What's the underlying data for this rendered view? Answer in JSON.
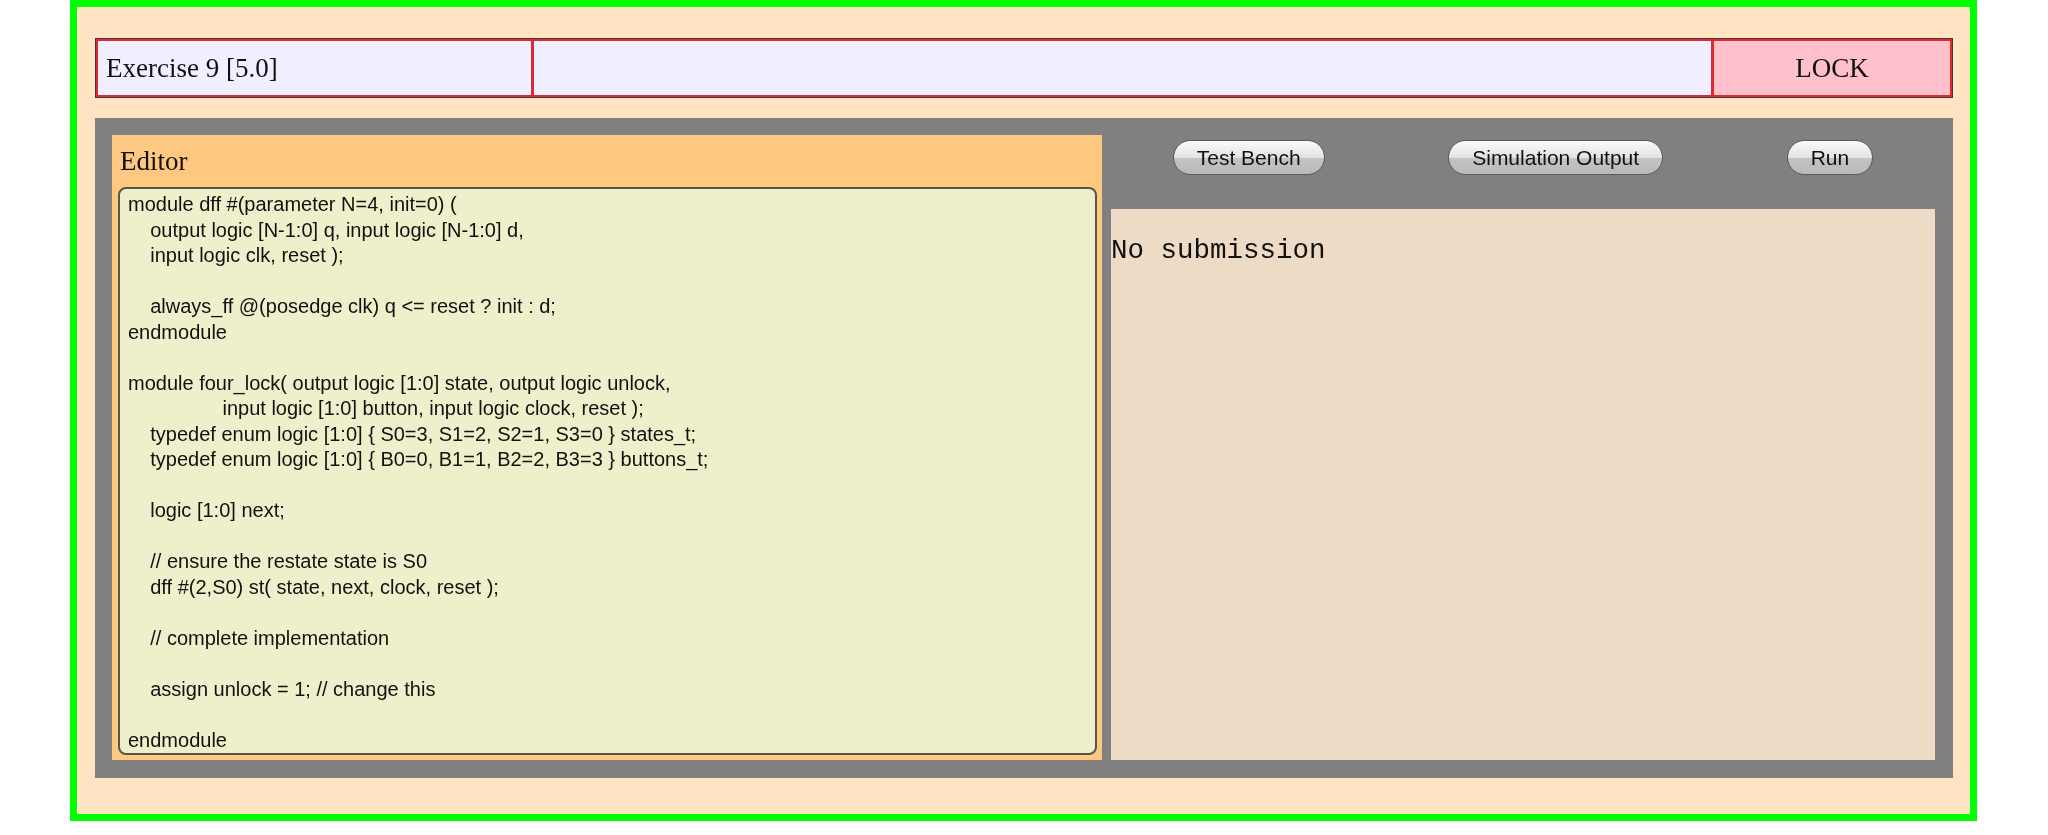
{
  "header": {
    "title": "Exercise 9 [5.0]",
    "status": "LOCK"
  },
  "editor": {
    "title": "Editor",
    "value": "module dff #(parameter N=4, init=0) (\n    output logic [N-1:0] q, input logic [N-1:0] d,\n    input logic clk, reset );\n\n    always_ff @(posedge clk) q <= reset ? init : d;\nendmodule\n\nmodule four_lock( output logic [1:0] state, output logic unlock,\n                 input logic [1:0] button, input logic clock, reset );\n    typedef enum logic [1:0] { S0=3, S1=2, S2=1, S3=0 } states_t;\n    typedef enum logic [1:0] { B0=0, B1=1, B2=2, B3=3 } buttons_t;\n\n    logic [1:0] next;\n\n    // ensure the restate state is S0\n    dff #(2,S0) st( state, next, clock, reset );\n\n    // complete implementation\n\n    assign unlock = 1; // change this\n\nendmodule"
  },
  "toolbar": {
    "buttons": [
      {
        "label": "Test Bench"
      },
      {
        "label": "Simulation Output"
      },
      {
        "label": "Run"
      }
    ]
  },
  "output": {
    "text": "No submission"
  }
}
